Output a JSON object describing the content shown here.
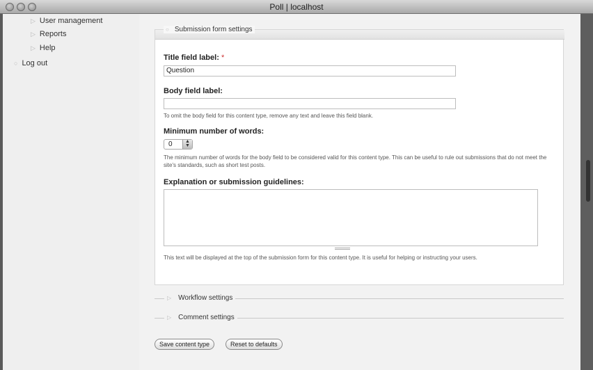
{
  "window": {
    "title": "Poll | localhost"
  },
  "sidebar": {
    "items": [
      {
        "label": "User management"
      },
      {
        "label": "Reports"
      },
      {
        "label": "Help"
      },
      {
        "label": "Log out"
      }
    ]
  },
  "form": {
    "submission_fieldset": {
      "legend": "Submission form settings"
    },
    "title_field": {
      "label": "Title field label:",
      "required_mark": "*",
      "value": "Question"
    },
    "body_field": {
      "label": "Body field label:",
      "value": "",
      "description": "To omit the body field for this content type, remove any text and leave this field blank."
    },
    "min_words": {
      "label": "Minimum number of words:",
      "value": "0",
      "description": "The minimum number of words for the body field to be considered valid for this content type. This can be useful to rule out submissions that do not meet the site's standards, such as short test posts."
    },
    "guidelines": {
      "label": "Explanation or submission guidelines:",
      "value": "",
      "description": "This text will be displayed at the top of the submission form for this content type. It is useful for helping or instructing your users."
    },
    "workflow_fieldset": {
      "legend": "Workflow settings"
    },
    "comment_fieldset": {
      "legend": "Comment settings"
    },
    "buttons": {
      "save": "Save content type",
      "reset": "Reset to defaults"
    }
  }
}
